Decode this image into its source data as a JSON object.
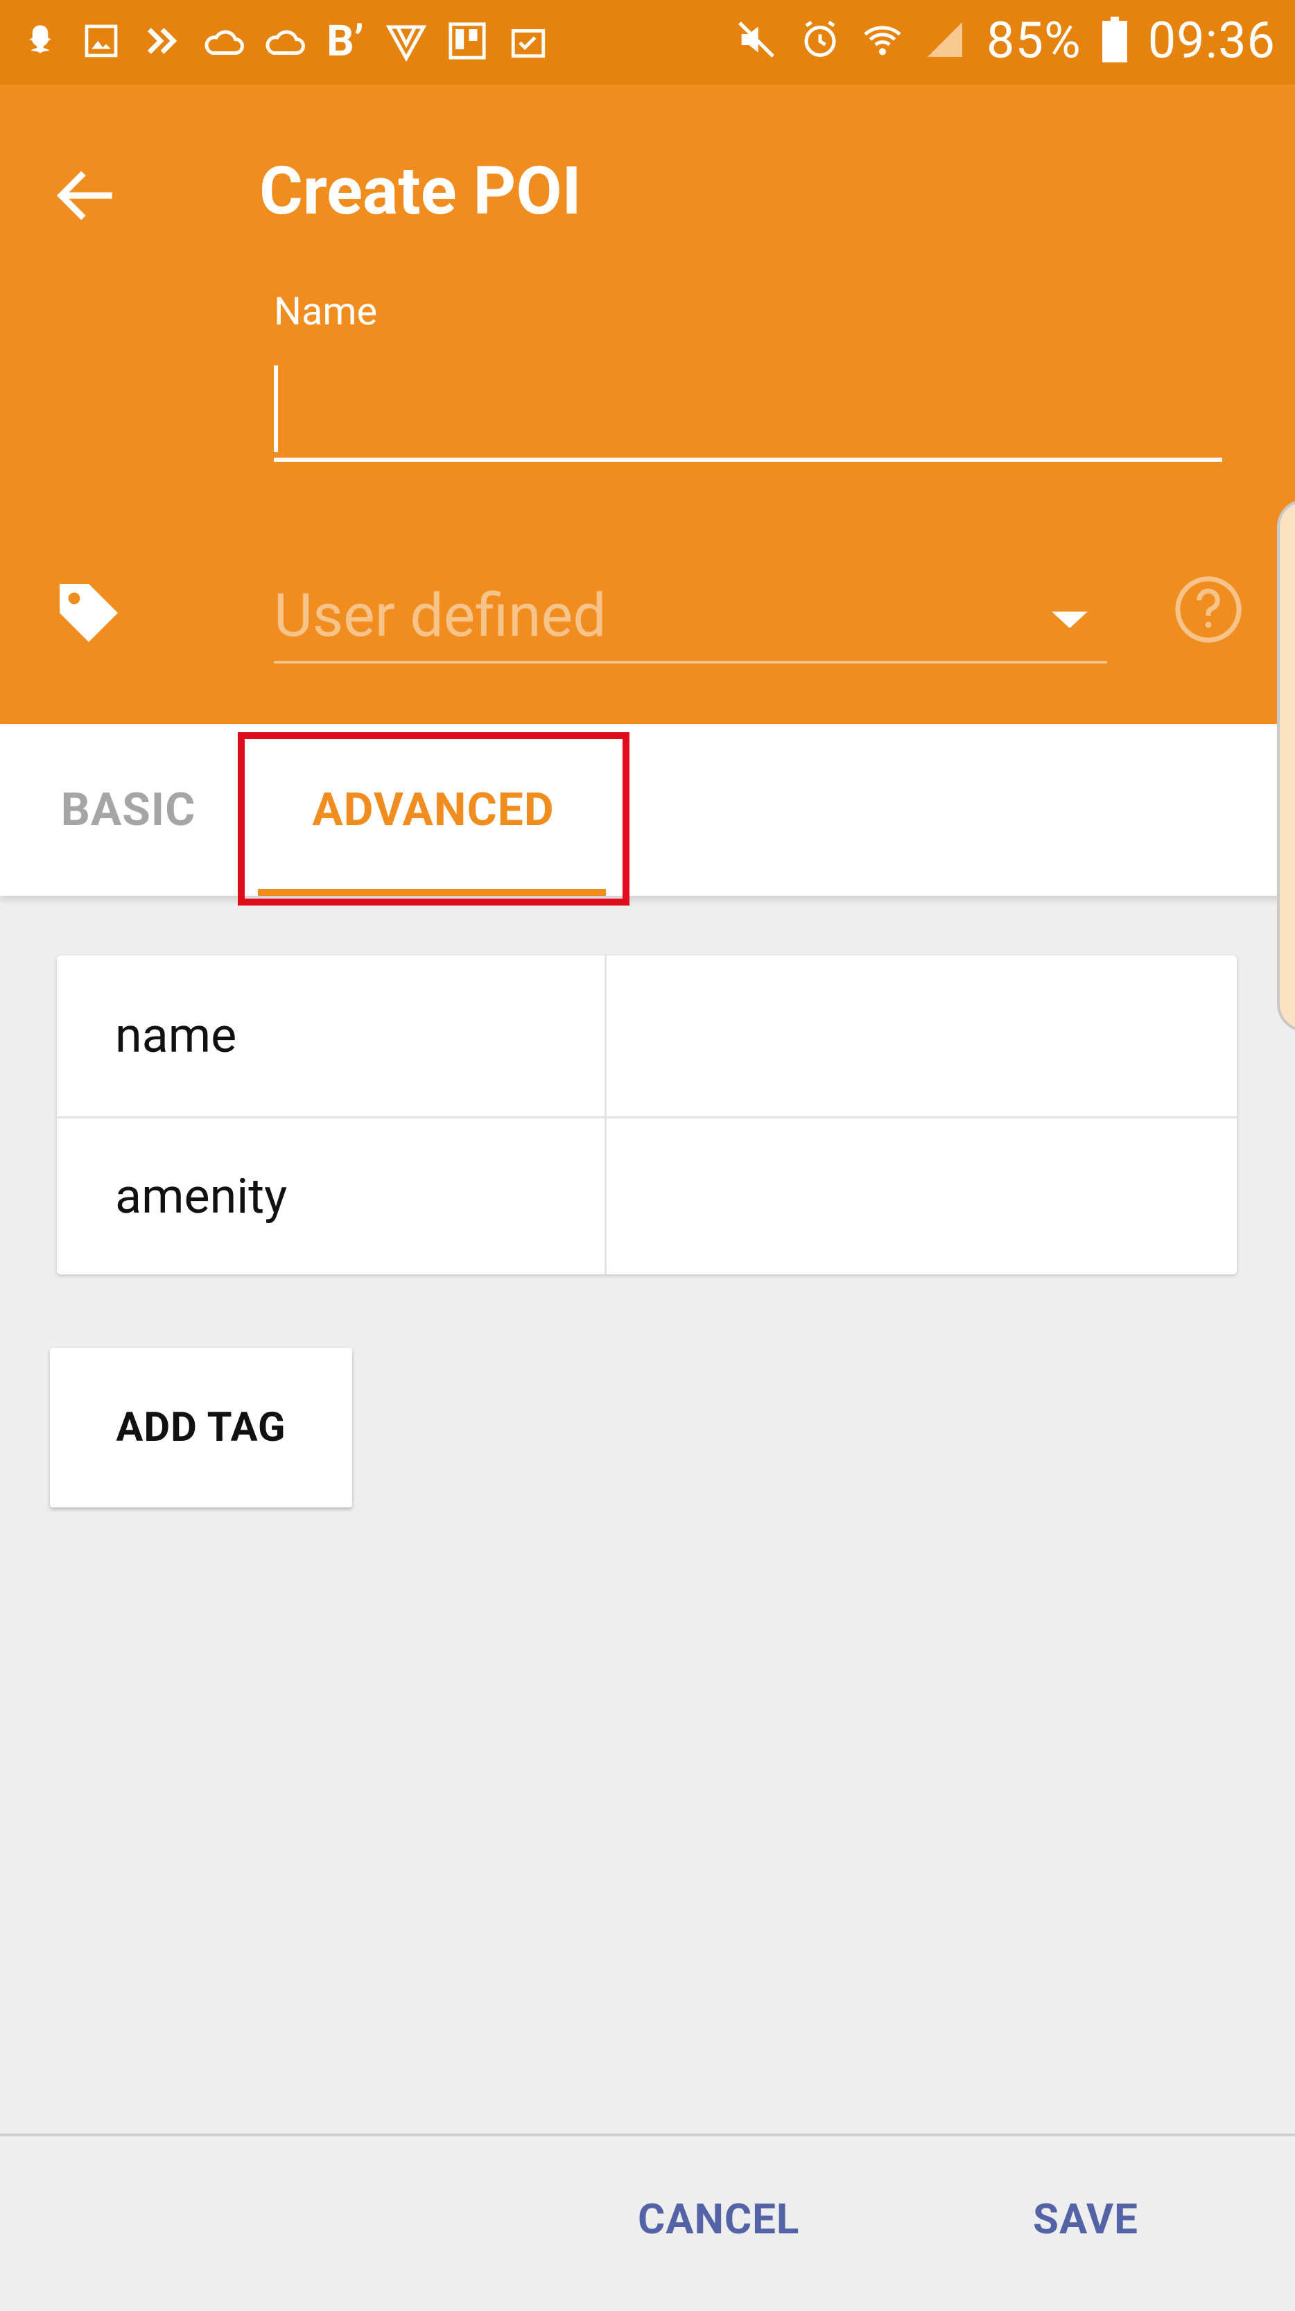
{
  "status_bar": {
    "battery": "85%",
    "time": "09:36"
  },
  "header": {
    "title": "Create POI",
    "name_label": "Name",
    "name_value": "",
    "type_select": "User defined"
  },
  "tabs": [
    {
      "label": "BASIC",
      "selected": false
    },
    {
      "label": "ADVANCED",
      "selected": true
    }
  ],
  "tags_table": {
    "rows": [
      {
        "key": "name",
        "value": ""
      },
      {
        "key": "amenity",
        "value": ""
      }
    ]
  },
  "add_tag_label": "ADD TAG",
  "actions": {
    "cancel": "CANCEL",
    "save": "SAVE"
  },
  "colors": {
    "status_bar": "#e5830e",
    "app_bar": "#f18d1e",
    "accent": "#f18d1e",
    "action_text": "#5463a6",
    "highlight": "#e00d1d"
  },
  "icons": {
    "status_left": [
      "snapchat-icon",
      "image-icon",
      "fast-forward-icon",
      "cloud-icon",
      "cloud-icon",
      "b-icon",
      "vpn-icon",
      "trello-icon",
      "clipboard-check-icon"
    ],
    "status_right": [
      "mute-icon",
      "alarm-icon",
      "wifi-icon",
      "signal-icon",
      "battery-icon"
    ],
    "back": "back-arrow-icon",
    "tag": "tag-icon",
    "help": "help-icon",
    "dropdown": "dropdown-arrow-icon"
  }
}
